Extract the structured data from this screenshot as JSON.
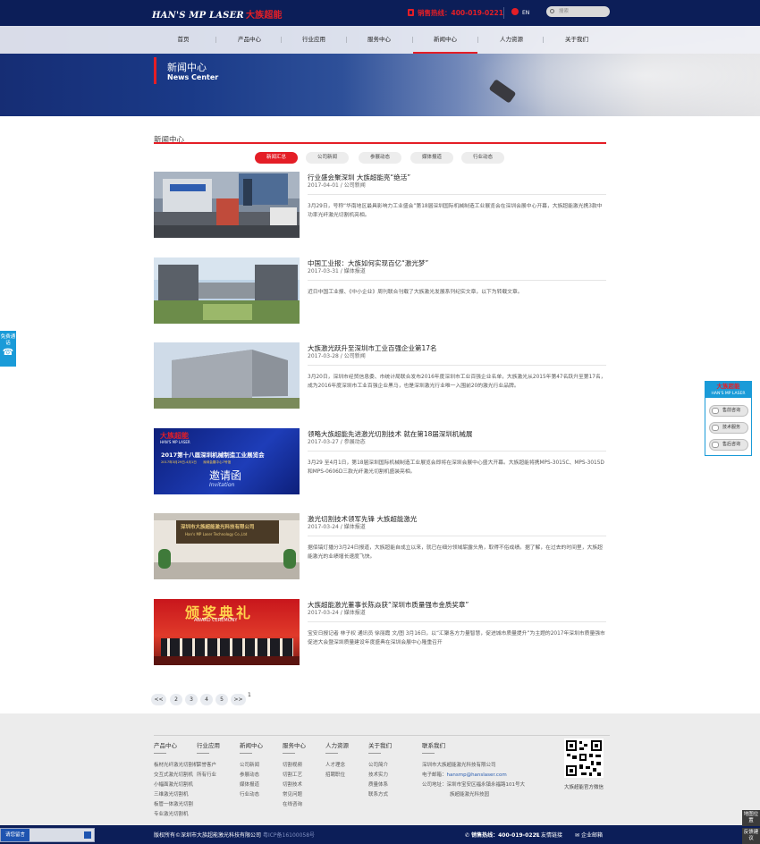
{
  "header": {
    "logo_en": "HAN'S MP LASER",
    "logo_cn": "大族超能",
    "hotline": "销售热线：400-019-0221",
    "lang": "EN",
    "search_placeholder": "搜索"
  },
  "nav": {
    "items": [
      "首页",
      "产品中心",
      "行业应用",
      "服务中心",
      "新闻中心",
      "人力资源",
      "关于我们"
    ]
  },
  "banner": {
    "title_cn": "新闻中心",
    "title_en": "News Center"
  },
  "section": {
    "title": "新闻中心"
  },
  "tabs": [
    "新闻汇总",
    "公司新闻",
    "参展动态",
    "媒体报道",
    "行业动态"
  ],
  "news": [
    {
      "title": "行业盛会聚深圳 大族超能亮“绝活”",
      "meta": "2017-04-01 / 公司新闻",
      "desc": "3月29日，号称“华南地区最具影响力工业盛会”第18届深圳国际机械制造工业展览会在深圳会展中心开幕，大族超能激光携3款中功率光纤激光切割机亮相。"
    },
    {
      "title": "中国工业报：大族如何实现百亿“激光梦”",
      "meta": "2017-03-31 / 媒体报道",
      "desc": "近日中国工业报、《中小企业》周刊联合刊载了大族激光发展系列纪实文章，以下为转载文章。"
    },
    {
      "title": "大族激光跃升至深圳市工业百强企业第17名",
      "meta": "2017-03-28 / 公司新闻",
      "desc": "3月20日，深圳市经贸信息委、市统计局联合发布2016年度深圳市工业百强企业名单，大族激光从2015年第47名跃升至第17名，成为2016年度深圳市工业百强企业黑马，也是深圳激光行业唯一入围前20的激光行业品牌。"
    },
    {
      "title": "领略大族超能先进激光切割技术 就在第18届深圳机械展",
      "meta": "2017-03-27 / 参展动态",
      "desc": "3月29 至4月1日，第18届深圳国际机械制造工业展览会即将在深圳会展中心盛大开幕。大族超能将携MPS-3015C、MPS-3015D和MPS-0606D三款光纤激光切割机盛装亮相。"
    },
    {
      "title": "激光切割技术领军先锋 大族超能激光",
      "meta": "2017-03-24 / 媒体报道",
      "desc": "据佰镐灯播分3月24日报道，大族超能自成立以来，就已在细分领域崭露头角，取得不俗成绩。据了解，在过去的时间里，大族超能激光的业绩增长速度飞快。"
    },
    {
      "title": "大族超能激光董事长陈焱获“深圳市质量强市金质奖章”",
      "meta": "2017-03-24 / 媒体报道",
      "desc": "宝安日报记者 林子权 通讯员 徐丽霞 文/图 3月16日，以“汇聚各方力量智慧，促进城市质量提升”为主题的2017年深圳市质量强市促进大会暨深圳质量建设年度盛典在深圳会展中心隆重召开"
    }
  ],
  "thumbs": {
    "t4_brand": "大族超能",
    "t4_brand_en": "HAN'S MP LASER",
    "t4_title": "2017第十八届深圳机械制造工业展览会",
    "t4_sub": "2017年3月29日-4月1日　　深圳会展中心7号馆",
    "t4_inv": "邀请函",
    "t4_inv_en": "Invitation",
    "t5_sign": "深圳市大族超能激光科技有限公司",
    "t5_sign_en": "Han's MP Laser Technology Co.,Ltd",
    "t6_title": "颁奖典礼",
    "t6_en": "AWARD CEREMONY"
  },
  "pagination": {
    "pages": [
      "<<",
      "2",
      "3",
      "4",
      "5",
      ">>"
    ],
    "current": "1"
  },
  "footer": {
    "columns": [
      {
        "head": "产品中心",
        "items": [
          "板材光纤激光切割机",
          "交互式激光切割机",
          "小幅面激光切割机",
          "三维激光切割机",
          "板管一体激光切割",
          "专业激光切割机"
        ]
      },
      {
        "head": "行业应用",
        "items": [
          "荣誉客户",
          "所有行业"
        ]
      },
      {
        "head": "新闻中心",
        "items": [
          "公司新闻",
          "参展动态",
          "媒体报道",
          "行业动态"
        ]
      },
      {
        "head": "服务中心",
        "items": [
          "切割视频",
          "切割工艺",
          "切割技术",
          "常见问题",
          "在线咨询"
        ]
      },
      {
        "head": "人力资源",
        "items": [
          "人才理念",
          "招聘职位"
        ]
      },
      {
        "head": "关于我们",
        "items": [
          "公司简介",
          "技术实力",
          "质量体系",
          "联系方式"
        ]
      }
    ],
    "contact": {
      "head": "联系我们",
      "company": "深圳市大族超能激光科技有限公司",
      "email_label": "电子邮箱：",
      "email": "hansmp@hanslaser.com",
      "addr_label": "公司地址：",
      "addr1": "深圳市宝安区福永镇永福路101号大",
      "addr2": "族超能激光科技园"
    },
    "qr_caption": "大族超能官方微信"
  },
  "bottom": {
    "copyright": "版权所有©深圳市大族超能激光科技有限公司",
    "icp": "粤ICP备16100058号",
    "hotline": "销售热线：400-019-0221",
    "links": [
      "友情链接",
      "企业邮箱"
    ]
  },
  "floats": {
    "left": "免费通话",
    "right_brand": "大族超能",
    "right_sub": "HAN'S MP LASER",
    "right_btns": [
      "售前咨询",
      "技术服务",
      "售后咨询"
    ],
    "chat": "请您留言",
    "side_top": "地图位置",
    "side_bottom": "反馈建议"
  },
  "colors": {
    "navy": "#0c1e58",
    "accent": "#e41e26",
    "float_blue": "#1a9bd8"
  }
}
